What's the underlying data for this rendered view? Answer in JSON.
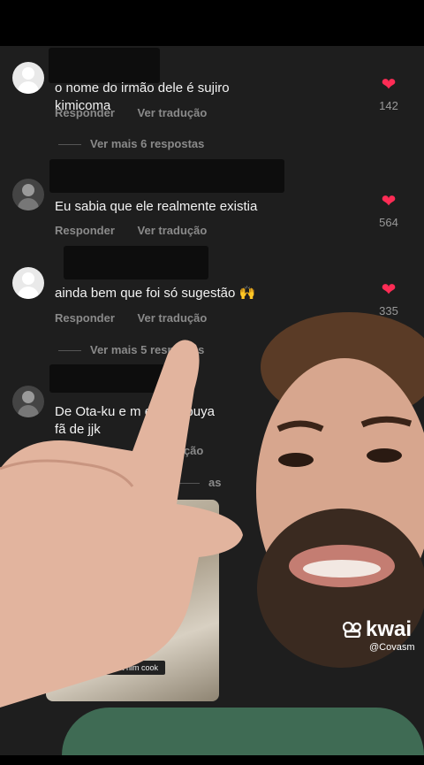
{
  "comments": [
    {
      "text": "o nome do irmão dele é sujiro kimicoma",
      "reply": "Responder",
      "translate": "Ver tradução",
      "likes": "142",
      "more": "Ver mais 6 respostas"
    },
    {
      "text": "Eu sabia que ele realmente existia",
      "reply": "Responder",
      "translate": "Ver tradução",
      "likes": "564"
    },
    {
      "text": "ainda bem que foi só sugestão 🙌",
      "reply": "Responder",
      "translate": "Ver tradução",
      "likes": "335",
      "more": "Ver mais 5 respostas"
    },
    {
      "text": "De Ota-ku e m     em Shibuya\nfã de jjk",
      "reply": "",
      "translate": "ução",
      "more": "as"
    }
  ],
  "thumbnail_caption": "Hol up, let him cook",
  "watermark": {
    "brand": "kwai",
    "handle": "@Covasm"
  },
  "colors": {
    "background": "#1e1e1e",
    "heart": "#fe2c55",
    "muted": "#8a8a8a"
  }
}
